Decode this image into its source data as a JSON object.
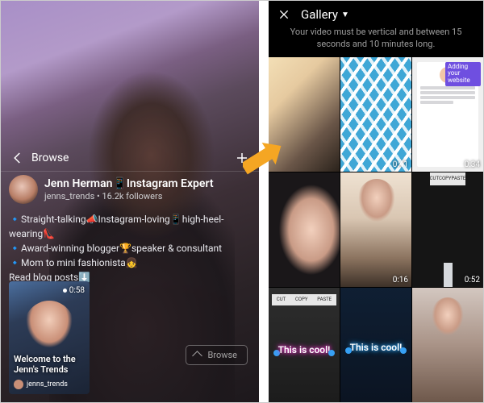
{
  "left": {
    "browse_label": "Browse",
    "profile": {
      "name": "Jenn Herman📱Instagram Expert",
      "handle_followers": "jenns_trends • 16.2k followers"
    },
    "bio": {
      "line1": "🔹Straight-talking📣Instagram-loving📱high-heel-wearing👠",
      "line2": "🔹Award-winning blogger🏆speaker & consultant",
      "line3": "🔹Mom to mini fashionista👧",
      "line4": "Read blog posts⬇️"
    },
    "thumb": {
      "duration": "0:58",
      "title": "Welcome to the Jenn's Trends",
      "username": "jenns_trends"
    },
    "browse_button": "Browse"
  },
  "right": {
    "gallery_label": "Gallery",
    "hint": "Your video must be vertical and between 15 seconds and 10 minutes long.",
    "cells": [
      {
        "duration": ""
      },
      {
        "duration": "0:41"
      },
      {
        "duration": "0:34",
        "badge": "Adding your website"
      },
      {
        "duration": ""
      },
      {
        "duration": "0:16"
      },
      {
        "duration": "0:52"
      },
      {
        "text": "This is cool!",
        "toolbar": [
          "CUT",
          "COPY",
          "PASTE"
        ]
      },
      {
        "text": "This is cool!"
      },
      {
        "duration": ""
      }
    ],
    "toolbar5": [
      "CUT",
      "COPY",
      "PASTE"
    ]
  }
}
